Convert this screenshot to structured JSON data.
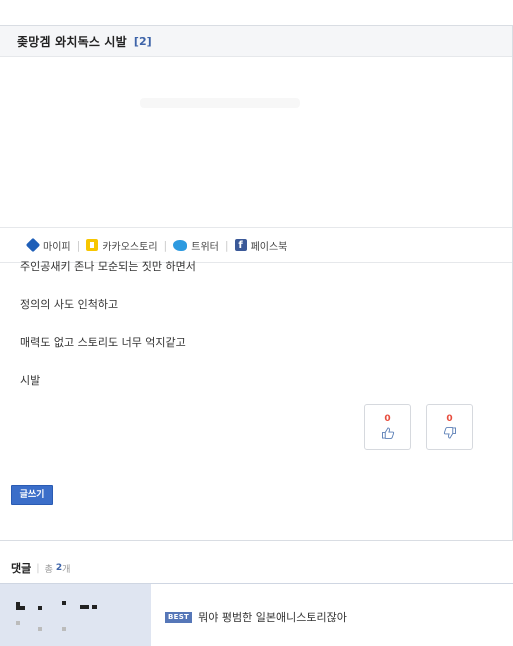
{
  "post": {
    "title": "좆망겜 와치독스 시발",
    "comment_count": "[2]"
  },
  "share": {
    "mypi": "마이피",
    "kakaostory": "카카오스토리",
    "twitter": "트위터",
    "facebook": "페이스북",
    "facebook_icon": "f"
  },
  "content": {
    "lines": [
      "주인공새키 존나 모순되는 짓만 하면서",
      "정의의 사도 인척하고",
      "매력도 없고 스토리도 너무 억지같고",
      "시발"
    ]
  },
  "votes": {
    "up": "0",
    "down": "0"
  },
  "write_button": "글쓰기",
  "comments": {
    "title": "댓글",
    "total_label": "총",
    "total_count": "2",
    "total_unit": "개",
    "best_badge": "BEST",
    "best_comment_text": "뭐야 평범한 일본애니스토리잖아"
  },
  "colors": {
    "accent": "#3b6ec9",
    "header_bg": "#f5f6f8",
    "vote_count": "#e74c3c",
    "comment_author_bg": "#dfe5f1"
  }
}
